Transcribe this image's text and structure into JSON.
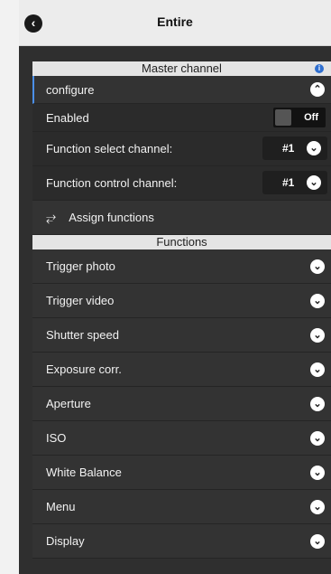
{
  "header": {
    "title": "Entire",
    "back_icon": "chevron-left-icon"
  },
  "master": {
    "section_label": "Master channel",
    "info_icon": "info-icon",
    "configure_label": "configure",
    "enabled_label": "Enabled",
    "enabled_state": "Off",
    "func_select_label": "Function select channel:",
    "func_select_value": "#1",
    "func_control_label": "Function control channel:",
    "func_control_value": "#1",
    "assign_label": "Assign functions"
  },
  "functions": {
    "section_label": "Functions",
    "items": [
      "Trigger photo",
      "Trigger video",
      "Shutter speed",
      "Exposure corr.",
      "Aperture",
      "ISO",
      "White Balance",
      "Menu",
      "Display"
    ]
  },
  "colors": {
    "accent": "#2f6fd0",
    "background": "#2f2f2f"
  }
}
